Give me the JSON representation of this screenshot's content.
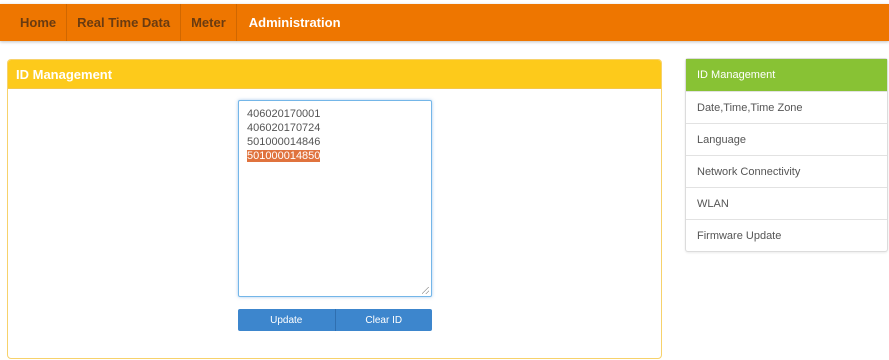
{
  "nav": {
    "items": [
      {
        "label": "Home"
      },
      {
        "label": "Real Time Data"
      },
      {
        "label": "Meter"
      },
      {
        "label": "Administration"
      }
    ]
  },
  "panel": {
    "title": "ID Management",
    "ids": [
      "406020170001",
      "406020170724",
      "501000014846",
      "501000014850"
    ],
    "selected_id": "501000014850",
    "update_label": "Update",
    "clear_label": "Clear ID"
  },
  "sidebar": {
    "items": [
      {
        "label": "ID Management"
      },
      {
        "label": "Date,Time,Time Zone"
      },
      {
        "label": "Language"
      },
      {
        "label": "Network Connectivity"
      },
      {
        "label": "WLAN"
      },
      {
        "label": "Firmware Update"
      }
    ]
  },
  "colors": {
    "topbar": "#ee7600",
    "panel_header": "#fdca1b",
    "button": "#3d86cd",
    "selection": "#e0733e",
    "sidebar_active": "#88c234"
  }
}
